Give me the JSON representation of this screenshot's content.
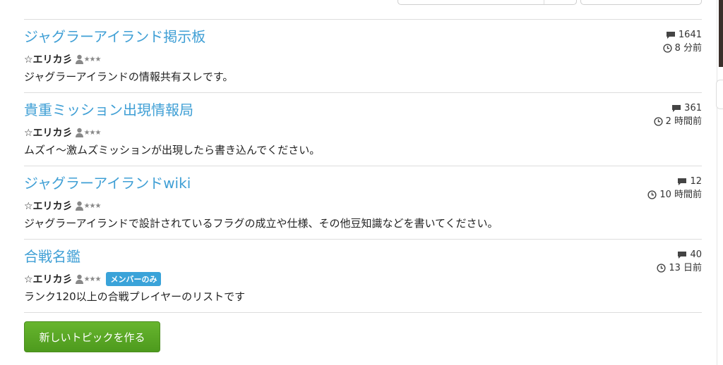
{
  "colors": {
    "title_link": "#3f9fd5",
    "badge_bg": "#3aa3d9",
    "button_green": "#5aa826"
  },
  "topics": [
    {
      "title": "ジャグラーアイランド掲示板",
      "author": "☆エリカ彡",
      "stars": "★★★",
      "badge": "",
      "description": "ジャグラーアイランドの情報共有スレです。",
      "comments": "1641",
      "time": "8 分前"
    },
    {
      "title": "貴重ミッション出現情報局",
      "author": "☆エリカ彡",
      "stars": "★★★",
      "badge": "",
      "description": "ムズイ〜激ムズミッションが出現したら書き込んでください。",
      "comments": "361",
      "time": "2 時間前"
    },
    {
      "title": "ジャグラーアイランドwiki",
      "author": "☆エリカ彡",
      "stars": "★★★",
      "badge": "",
      "description": "ジャグラーアイランドで設計されているフラグの成立や仕様、その他豆知識などを書いてください。",
      "comments": "12",
      "time": "10 時間前"
    },
    {
      "title": "合戦名鑑",
      "author": "☆エリカ彡",
      "stars": "★★★",
      "badge": "メンバーのみ",
      "description": "ランク120以上の合戦プレイヤーのリストです",
      "comments": "40",
      "time": "13 日前"
    }
  ],
  "new_topic_button": "新しいトピックを作る"
}
